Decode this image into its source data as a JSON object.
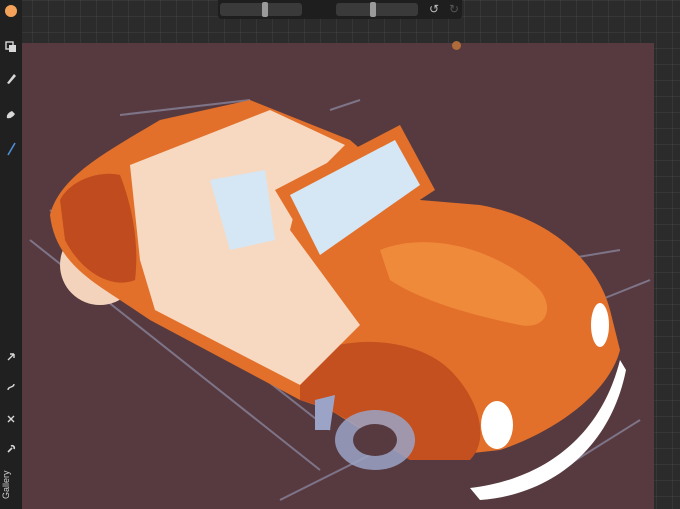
{
  "sidebar": {
    "gallery_label": "Gallery",
    "icons": [
      "layers-icon",
      "brush-icon",
      "smudge-icon",
      "line-tool-icon",
      "arrow-icon",
      "curve-icon",
      "shape-icon",
      "wrench-icon"
    ]
  },
  "toolbar": {
    "icons": [
      "undo-icon",
      "redo-icon"
    ],
    "undo_glyph": "↺",
    "redo_glyph": "↻"
  },
  "colors": {
    "canvas_background": "#573a3f",
    "current_color": "#f4a25a",
    "car_body": "#e2702a",
    "car_interior": "#f7d9c1",
    "windshield": "#d5e6f4"
  },
  "canvas": {
    "subject": "car-illustration"
  }
}
